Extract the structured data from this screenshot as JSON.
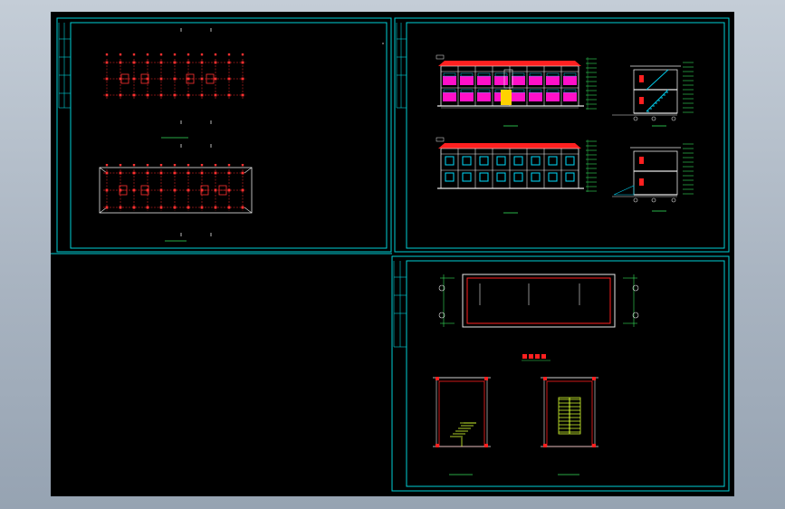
{
  "viewport": {
    "background_color": "#000000",
    "window_color": "#b3bdc9"
  },
  "colors": {
    "frame": "#00cfd6",
    "axis": "#ff2a2a",
    "column": "#ff3030",
    "grid": "#e8e8e8",
    "dim": "#34e05a",
    "text": "#34e05a",
    "roof": "#ff2020",
    "floor_band": "#ff10c8",
    "window": "#00c8e6",
    "door": "#ffd200",
    "stair": "#d8ff30",
    "section_lines": "#e8e8e8"
  },
  "sheets": [
    {
      "id": "foundation-plan-sheet",
      "content": "plan-layouts"
    },
    {
      "id": "elevations-sheet",
      "content": "elevations-and-sections"
    },
    {
      "id": "roof-and-stair-sheet",
      "content": "roof-plan-and-stair-details"
    }
  ]
}
